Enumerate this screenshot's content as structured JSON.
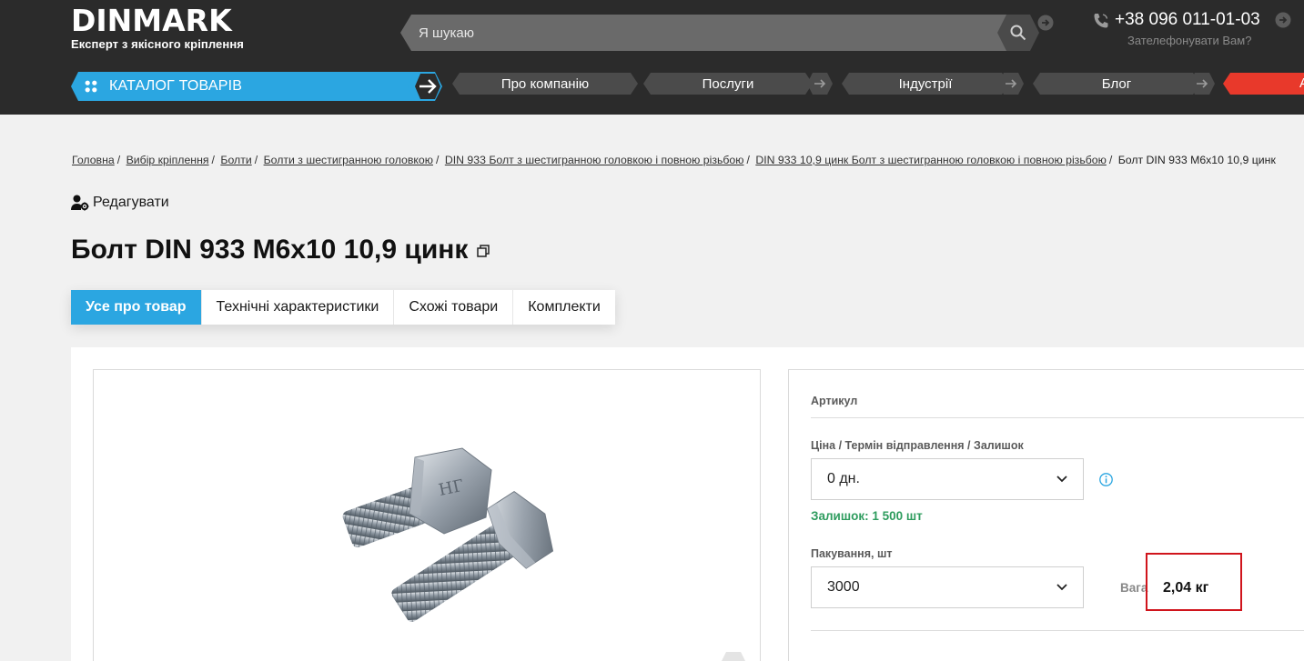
{
  "header": {
    "logo": {
      "text": "DINMARK",
      "tagline": "Експерт з якісного кріплення"
    },
    "search": {
      "placeholder": "Я шукаю"
    },
    "phone": {
      "number": "+38 096 011-01-03",
      "callback": "Зателефонувати Вам?"
    },
    "nav": {
      "catalog_label": "КАТАЛОГ ТОВАРІВ",
      "items": [
        {
          "label": "Про компанію"
        },
        {
          "label": "Послуги"
        },
        {
          "label": "Індустрії"
        },
        {
          "label": "Блог"
        }
      ],
      "cut_item": "А"
    }
  },
  "breadcrumb": [
    "Головна",
    "Вибір кріплення",
    "Болти",
    "Болти з шестигранною головкою",
    "DIN 933 Болт з шестигранною головкою і повною різьбою",
    "DIN 933 10,9 цинк Болт з шестигранною головкою і повною різьбою",
    "Болт DIN 933 М6х10 10,9 цинк"
  ],
  "edit_label": "Редагувати",
  "product": {
    "title": "Болт DIN 933 М6х10 10,9 цинк",
    "bolt_marking": "НГ"
  },
  "tabs": [
    {
      "label": "Усе про товар",
      "active": true
    },
    {
      "label": "Технічні характеристики",
      "active": false
    },
    {
      "label": "Схожі товари",
      "active": false
    },
    {
      "label": "Комплекти",
      "active": false
    }
  ],
  "info": {
    "article_label": "Артикул",
    "price_label": "Ціна / Термін відправлення / Залишок",
    "term_value": "0 дн.",
    "stock_text": "Залишок: 1 500 шт",
    "packing_label": "Пакування, шт",
    "packing_value": "3000",
    "weight_label": "Вага",
    "weight_value": "2,04 кг"
  },
  "colors": {
    "accent": "#2ba6e1",
    "header_bg": "#2b2b2b",
    "stock_green": "#2e9c5e",
    "highlight_red": "#d0141c",
    "nav_red": "#e8392b"
  }
}
